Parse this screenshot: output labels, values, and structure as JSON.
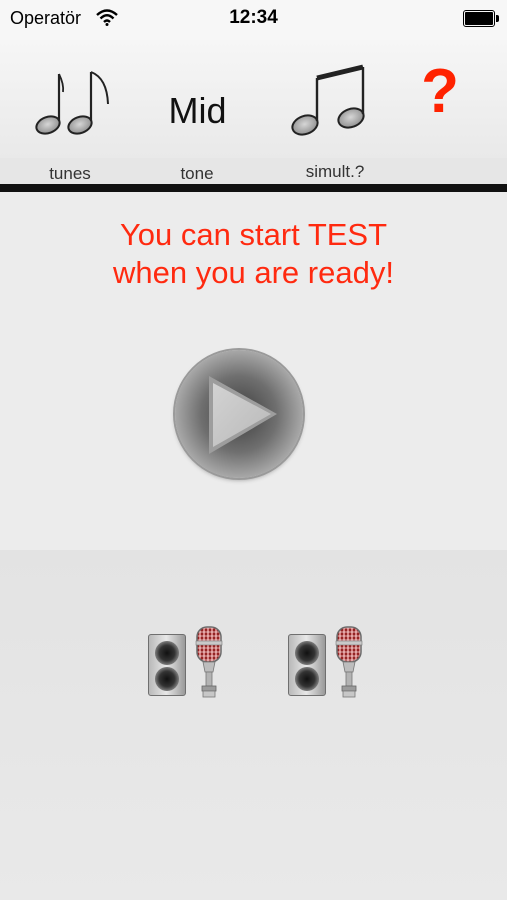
{
  "status_bar": {
    "carrier": "Operatör",
    "time": "12:34",
    "icons": [
      "wifi-icon",
      "battery-icon"
    ]
  },
  "header": {
    "tabs": [
      {
        "icon": "two-eighth-notes-icon",
        "label": "tunes"
      },
      {
        "icon_text": "Mid",
        "label": "tone"
      },
      {
        "icon": "beamed-notes-icon",
        "label": "simult.?"
      },
      {
        "icon_text": "?",
        "label": ""
      }
    ]
  },
  "main": {
    "message_line1": "You can start TEST",
    "message_line2": "when you are ready!",
    "play_icon": "play-icon"
  },
  "devices": [
    {
      "speaker_icon": "speaker-icon",
      "mic_icon": "microphone-icon"
    },
    {
      "speaker_icon": "speaker-icon",
      "mic_icon": "microphone-icon"
    }
  ],
  "colors": {
    "accent_red": "#ff2a10",
    "help_red": "#ff2200",
    "divider": "#111111",
    "background": "#ececec"
  }
}
